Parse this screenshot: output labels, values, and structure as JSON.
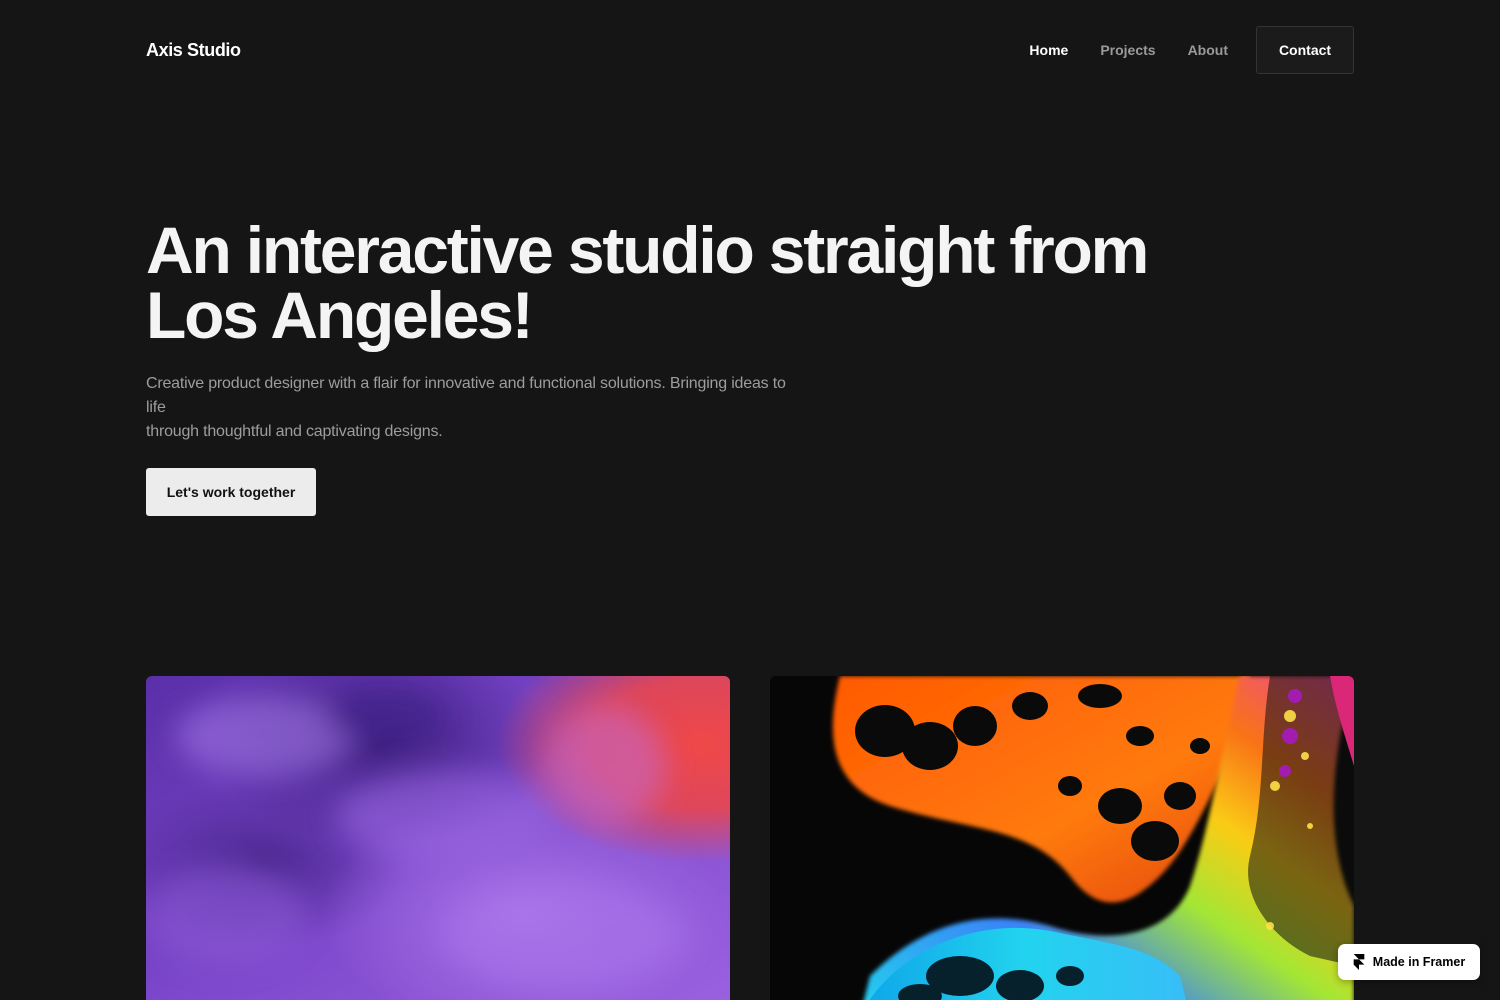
{
  "header": {
    "logo": "Axis Studio",
    "nav": [
      {
        "label": "Home",
        "active": true
      },
      {
        "label": "Projects",
        "active": false
      },
      {
        "label": "About",
        "active": false
      }
    ],
    "contact_label": "Contact"
  },
  "hero": {
    "title_line1": "An interactive studio straight from",
    "title_line2": "Los Angeles!",
    "subtitle_line1": "Creative product designer with a flair for innovative and functional solutions. Bringing ideas to life",
    "subtitle_line2": "through thoughtful and captivating designs.",
    "cta_label": "Let's work together"
  },
  "projects": [
    {
      "image": "purple-smoke-image"
    },
    {
      "image": "fluid-art-image"
    }
  ],
  "badge": {
    "label": "Made in Framer",
    "icon": "framer-logo-icon"
  },
  "colors": {
    "background": "#151516",
    "text_primary": "#ffffff",
    "text_muted": "#9a9a9a",
    "cta_background": "#ececec"
  }
}
